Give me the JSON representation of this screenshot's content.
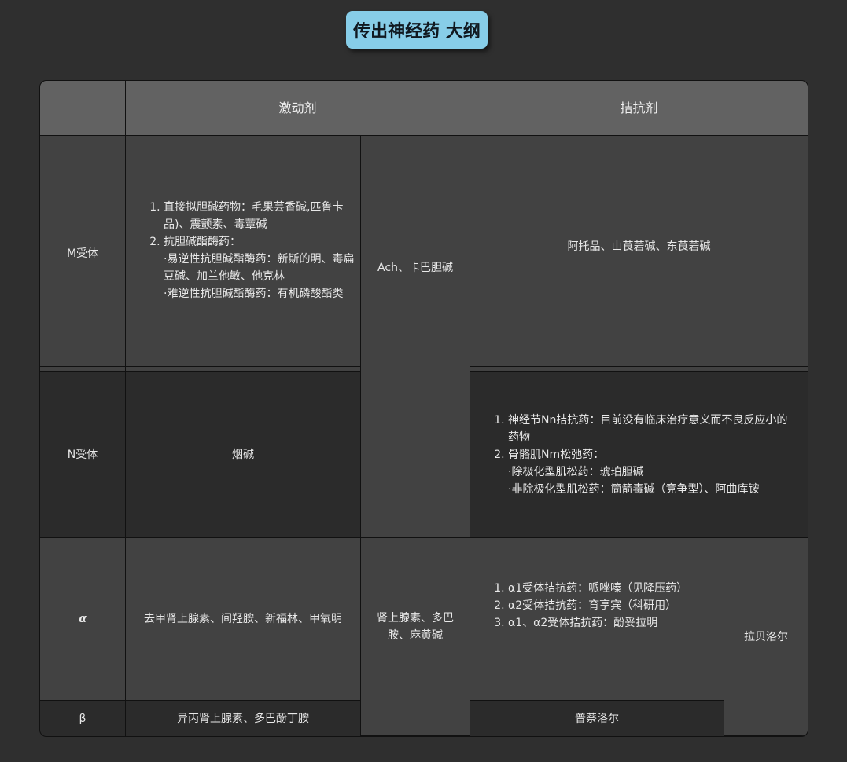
{
  "title": "传出神经药 大纲",
  "headers": {
    "corner": "",
    "agonist": "激动剂",
    "antagonist": "拮抗剂"
  },
  "rows": {
    "m": {
      "label": "M受体",
      "antagonist": "阿托品、山莨菪碱、东莨菪碱"
    },
    "n": {
      "label": "N受体",
      "agonist": "烟碱"
    },
    "alpha": {
      "label": "α",
      "agonist": "去甲肾上腺素、间羟胺、新福林、甲氧明"
    },
    "beta": {
      "label": "β",
      "agonist": "异丙肾上腺素、多巴酚丁胺",
      "antagonist": "普萘洛尔"
    }
  },
  "m_agonist": {
    "item1": "直接拟胆碱药物：毛果芸香碱,匹鲁卡品)、震颤素、毒蕈碱",
    "item2": "抗胆碱酯酶药：",
    "sub1": "·易逆性抗胆碱酯酶药：新斯的明、毒扁豆碱、加兰他敏、他克林",
    "sub2": "·难逆性抗胆碱酯酶药：有机磷酸酯类"
  },
  "shared_mn_agonist": "Ach、卡巴胆碱",
  "n_antagonist": {
    "item1": "神经节Nn拮抗药：目前没有临床治疗意义而不良反应小的药物",
    "item2": "骨骼肌Nm松弛药：",
    "sub1": "·除极化型肌松药：琥珀胆碱",
    "sub2": "·非除极化型肌松药：筒箭毒碱（竞争型）、阿曲库铵"
  },
  "shared_ab_agonist": "肾上腺素、多巴胺、麻黄碱",
  "alpha_antagonist": {
    "item1": "α1受体拮抗药：哌唑嗪（见降压药）",
    "item2": "α2受体拮抗药：育亨宾（科研用）",
    "item3": "α1、α2受体拮抗药：酚妥拉明"
  },
  "shared_ab_antagonist": "拉贝洛尔"
}
